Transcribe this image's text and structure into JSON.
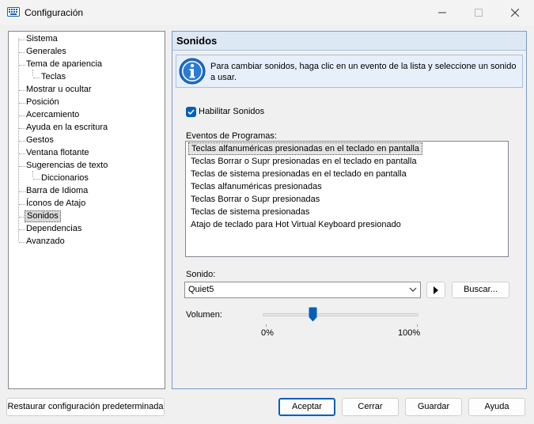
{
  "window": {
    "title": "Configuración",
    "icon": "keyboard-icon",
    "controls": [
      "minimize-icon",
      "maximize-icon",
      "close-icon"
    ]
  },
  "tree": {
    "items": [
      {
        "label": "Sistema",
        "level": 0
      },
      {
        "label": "Generales",
        "level": 0
      },
      {
        "label": "Tema de apariencia",
        "level": 0
      },
      {
        "label": "Teclas",
        "level": 1
      },
      {
        "label": "Mostrar u ocultar",
        "level": 0
      },
      {
        "label": "Posición",
        "level": 0
      },
      {
        "label": "Acercamiento",
        "level": 0
      },
      {
        "label": "Ayuda en la escritura",
        "level": 0
      },
      {
        "label": "Gestos",
        "level": 0
      },
      {
        "label": "Ventana flotante",
        "level": 0
      },
      {
        "label": "Sugerencias de texto",
        "level": 0
      },
      {
        "label": "Diccionarios",
        "level": 1
      },
      {
        "label": "Barra de Idioma",
        "level": 0
      },
      {
        "label": "Íconos de Atajo",
        "level": 0
      },
      {
        "label": "Sonidos",
        "level": 0,
        "selected": true
      },
      {
        "label": "Dependencias",
        "level": 0
      },
      {
        "label": "Avanzado",
        "level": 0
      }
    ]
  },
  "panel": {
    "title": "Sonidos",
    "info_text": "Para cambiar sonidos, haga clic en un evento de la lista y seleccione un sonido a usar.",
    "enable_sounds_label": "Habilitar Sonidos",
    "enable_sounds_checked": true,
    "events_label": "Eventos de Programas:",
    "events": [
      "Teclas alfanuméricas presionadas en el teclado en pantalla",
      "Teclas Borrar o Supr presionadas en el teclado en pantalla",
      "Teclas de sistema presionadas en el teclado en pantalla",
      "Teclas alfanuméricas presionadas",
      "Teclas Borrar o Supr presionadas",
      "Teclas de sistema presionadas",
      "Atajo de teclado para Hot Virtual Keyboard presionado"
    ],
    "selected_event_index": 0,
    "sound_label": "Sonido:",
    "sound_value": "Quiet5",
    "browse_label": "Buscar...",
    "volume_label": "Volumen:",
    "volume_min": "0%",
    "volume_max": "100%",
    "volume_level": 0.31
  },
  "buttons": {
    "restore": "Restaurar configuración predeterminada",
    "accept": "Aceptar",
    "cancel": "Cerrar",
    "save": "Guardar",
    "help": "Ayuda"
  },
  "colors": {
    "accent": "#005fb8",
    "panel_header": "#dde8f5",
    "info_bg": "#e7effa"
  }
}
